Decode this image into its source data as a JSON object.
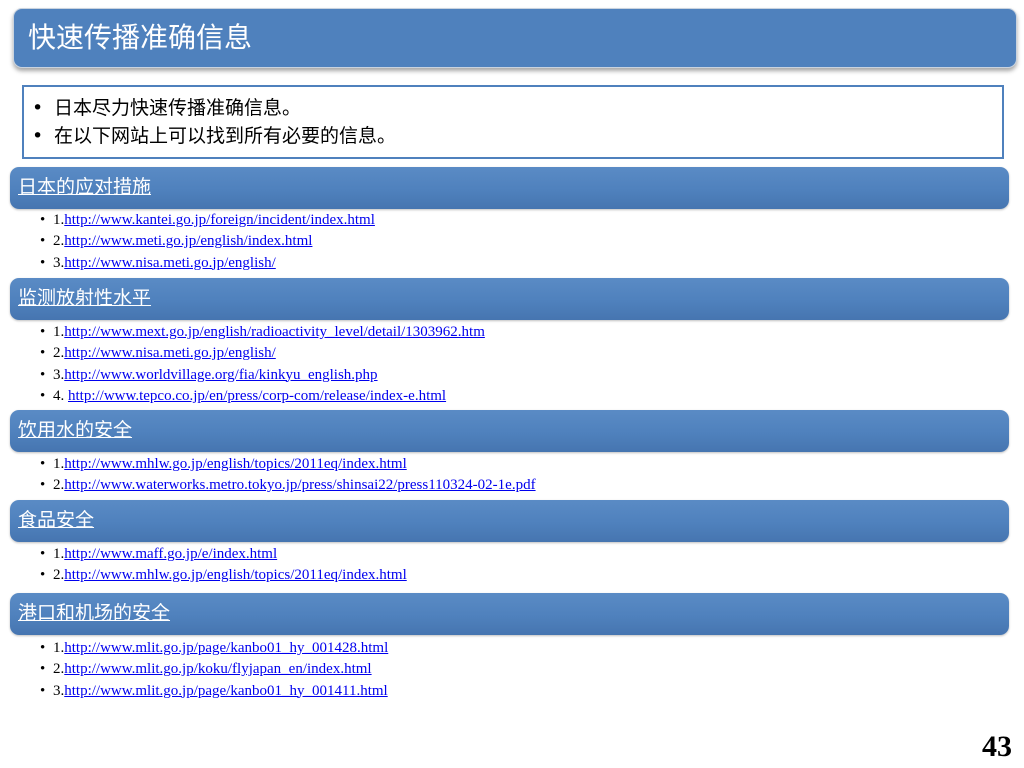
{
  "title": "快速传播准确信息",
  "intro": [
    "日本尽力快速传播准确信息。",
    "在以下网站上可以找到所有必要的信息。"
  ],
  "sections": [
    {
      "label": "日本的应对措施",
      "links": [
        {
          "prefix": "1.",
          "url": "http://www.kantei.go.jp/foreign/incident/index.html"
        },
        {
          "prefix": "2.",
          "url": "http://www.meti.go.jp/english/index.html"
        },
        {
          "prefix": "3.",
          "url": "http://www.nisa.meti.go.jp/english/"
        }
      ]
    },
    {
      "label": "监测放射性水平",
      "links": [
        {
          "prefix": "1.",
          "url": "http://www.mext.go.jp/english/radioactivity_level/detail/1303962.htm"
        },
        {
          "prefix": "2.",
          "url": "http://www.nisa.meti.go.jp/english/"
        },
        {
          "prefix": "3.",
          "url": "http://www.worldvillage.org/fia/kinkyu_english.php"
        },
        {
          "prefix": "4. ",
          "url": "http://www.tepco.co.jp/en/press/corp-com/release/index-e.html"
        }
      ]
    },
    {
      "label": "饮用水的安全",
      "links": [
        {
          "prefix": "1.",
          "url": "http://www.mhlw.go.jp/english/topics/2011eq/index.html"
        },
        {
          "prefix": "2.",
          "url": "http://www.waterworks.metro.tokyo.jp/press/shinsai22/press110324-02-1e.pdf"
        }
      ]
    },
    {
      "label": "食品安全",
      "links": [
        {
          "prefix": "1.",
          "url": "http://www.maff.go.jp/e/index.html"
        },
        {
          "prefix": "2.",
          "url": "http://www.mhlw.go.jp/english/topics/2011eq/index.html"
        }
      ]
    },
    {
      "label": "港口和机场的安全",
      "links": [
        {
          "prefix": "1.",
          "url": "http://www.mlit.go.jp/page/kanbo01_hy_001428.html"
        },
        {
          "prefix": "2.",
          "url": "http://www.mlit.go.jp/koku/flyjapan_en/index.html"
        },
        {
          "prefix": "3.",
          "url": "http://www.mlit.go.jp/page/kanbo01_hy_001411.html"
        }
      ]
    }
  ],
  "page_number": "43",
  "colors": {
    "header_blue": "#4f81bd",
    "link_blue": "#0000ee"
  }
}
